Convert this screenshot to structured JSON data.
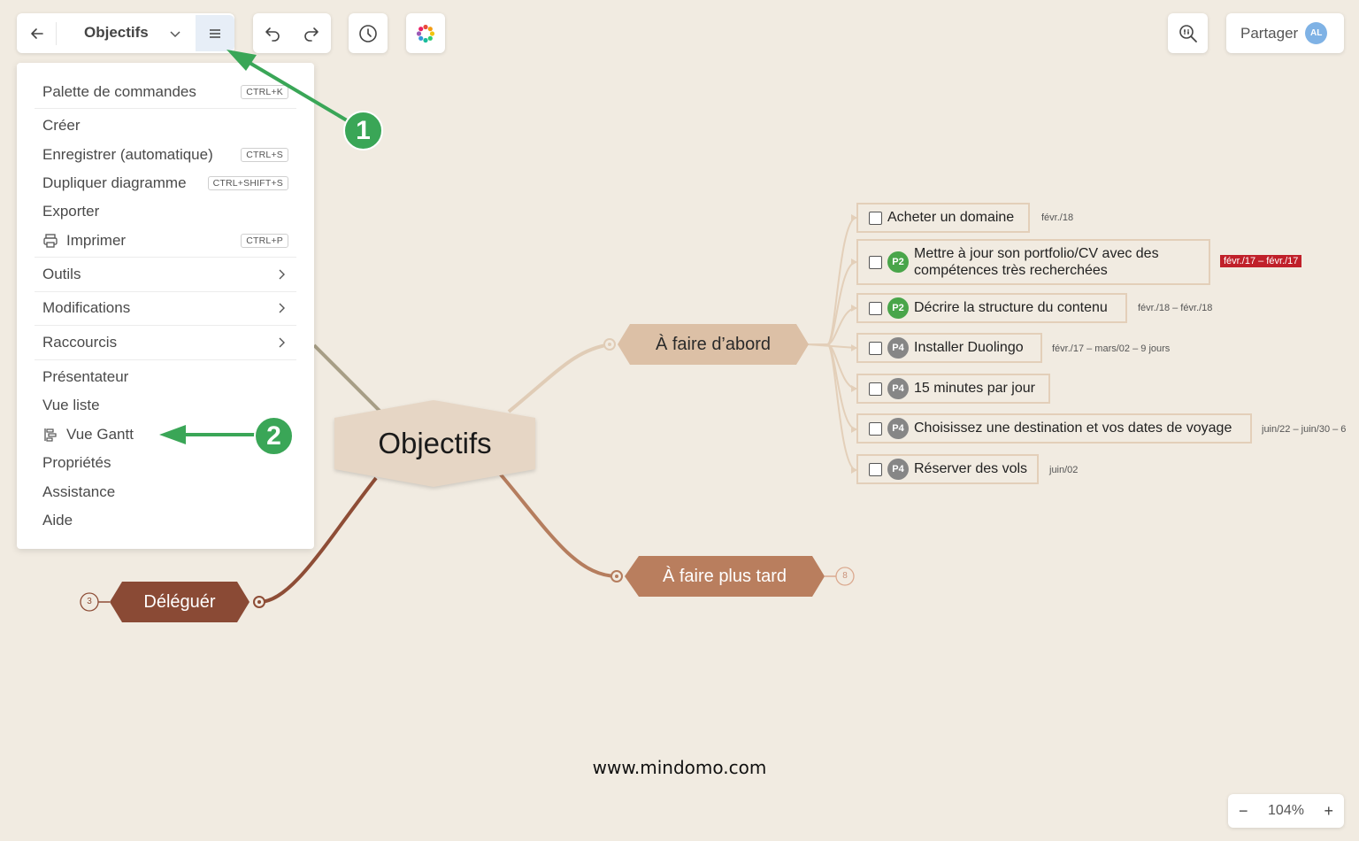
{
  "toolbar": {
    "title": "Objectifs",
    "share_label": "Partager",
    "avatar_initials": "AL"
  },
  "menu": {
    "items": [
      {
        "label": "Palette de commandes",
        "shortcut": "CTRL+K"
      },
      {
        "label": "Créer"
      },
      {
        "label": "Enregistrer (automatique)",
        "shortcut": "CTRL+S"
      },
      {
        "label": "Dupliquer diagramme",
        "shortcut": "CTRL+SHIFT+S"
      },
      {
        "label": "Exporter"
      },
      {
        "label": "Imprimer",
        "shortcut": "CTRL+P",
        "icon": "printer-icon"
      },
      {
        "label": "Outils",
        "submenu": true
      },
      {
        "label": "Modifications",
        "submenu": true
      },
      {
        "label": "Raccourcis",
        "submenu": true
      },
      {
        "label": "Présentateur"
      },
      {
        "label": "Vue liste"
      },
      {
        "label": "Vue Gantt",
        "icon": "gantt-icon"
      },
      {
        "label": "Propriétés"
      },
      {
        "label": "Assistance"
      },
      {
        "label": "Aide"
      }
    ]
  },
  "annotations": {
    "step1": "1",
    "step2": "2",
    "color": "#3aa657"
  },
  "map": {
    "central": "Objectifs",
    "topic_first": "À faire d’abord",
    "topic_later": "À faire plus tard",
    "topic_later_count": "8",
    "topic_delegate": "Déléguér",
    "topic_delegate_count": "3",
    "tasks": [
      {
        "label": "Acheter un domaine",
        "date": "févr./18"
      },
      {
        "label_line1": "Mettre à jour son portfolio/CV avec des",
        "label_line2": "compétences très recherchées",
        "priority": "P2",
        "date": "févr./17 – févr./17",
        "overdue": true
      },
      {
        "label": "Décrire la structure du contenu",
        "priority": "P2",
        "date": "févr./18 – févr./18"
      },
      {
        "label": "Installer Duolingo",
        "priority": "P4",
        "date": "févr./17 – mars/02 – 9 jours"
      },
      {
        "label": "15 minutes par jour",
        "priority": "P4"
      },
      {
        "label": "Choisissez une destination et vos dates de voyage",
        "priority": "P4",
        "date": "juin/22 – juin/30 – 6"
      },
      {
        "label": "Réserver des vols",
        "priority": "P4",
        "date": "juin/02"
      }
    ]
  },
  "watermark": "www.mindomo.com",
  "zoom": {
    "minus": "−",
    "value": "104%",
    "plus": "+"
  },
  "colors": {
    "background": "#f1ebe1",
    "central_node": "#e6d6c5",
    "first_node": "#dcc0a6",
    "later_node": "#b97e5e",
    "delegate_node": "#8a4a35",
    "overdue": "#c0202a"
  }
}
